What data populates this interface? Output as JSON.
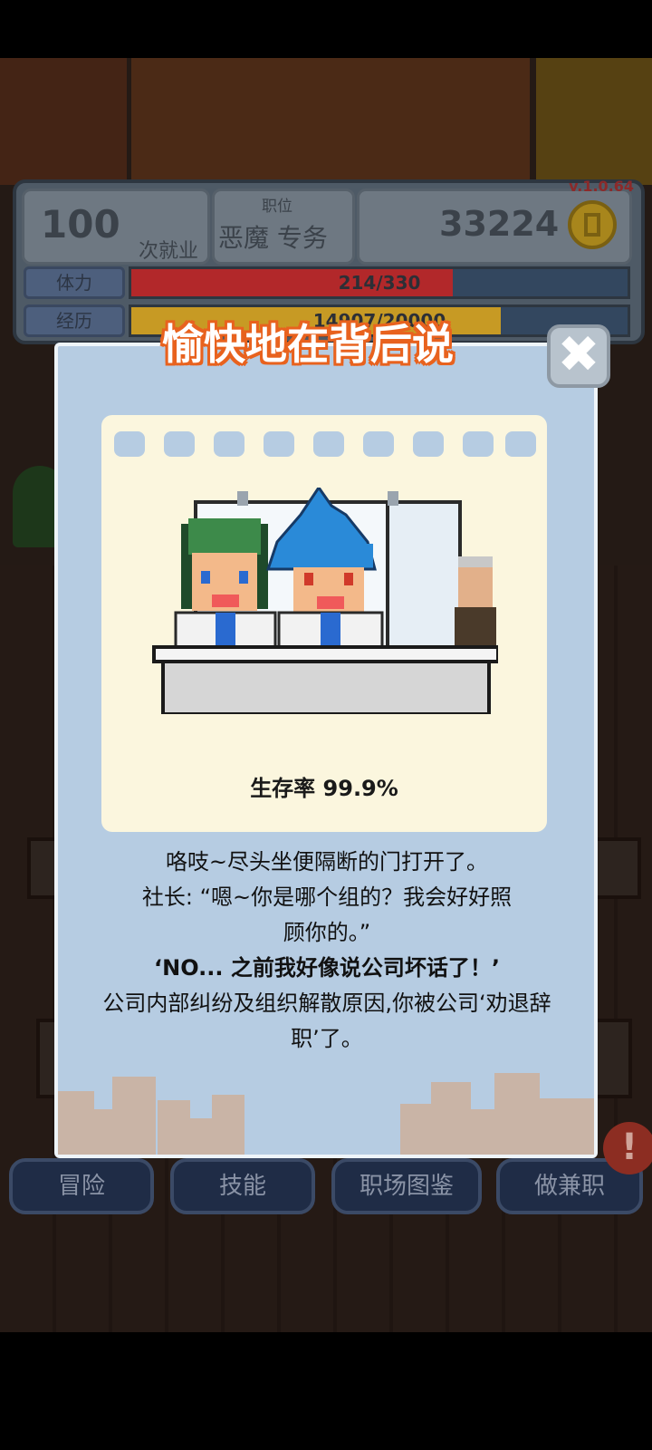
{
  "hud": {
    "job_count": "100",
    "job_count_unit": "次就业",
    "position_label": "职位",
    "position_value": "恶魔 专务",
    "money": "33224",
    "version": "v.1.0.64",
    "stamina_label": "体力",
    "stamina_value": "214/330",
    "stamina_fraction": 0.648,
    "experience_label": "经历",
    "experience_value": "14907/20000",
    "experience_fraction": 0.745
  },
  "modal": {
    "title": "愉快地在背后说",
    "close_icon": "close-icon",
    "survival_rate": "生存率 99.9%",
    "story_lines": [
      "咯吱~尽头坐便隔断的门打开了。",
      "社长: “嗯~你是哪个组的？我会好好照顾你的。”",
      "‘NO... 之前我好像说公司坏话了！’",
      "公司内部纠纷及组织解散原因,你被公司‘劝退辞职’了。"
    ]
  },
  "nav": {
    "adventure": "冒险",
    "skills": "技能",
    "workplace_guide": "职场图鉴",
    "part_time": "做兼职",
    "alert": "!"
  },
  "colors": {
    "title_outline": "#e8621e",
    "stamina_fill": "#b2282a",
    "experience_fill": "#c79a24",
    "modal_bg": "#b6cce2",
    "notebook_bg": "#fbf6de"
  }
}
